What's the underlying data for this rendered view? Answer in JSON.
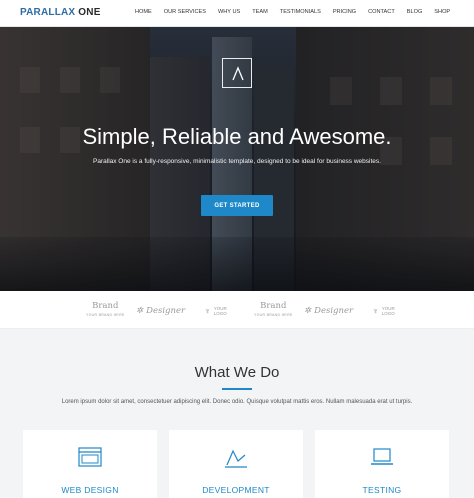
{
  "header": {
    "logo_part1": "PARALLAX",
    "logo_part2": "ONE",
    "nav": [
      "HOME",
      "OUR SERVICES",
      "WHY US",
      "TEAM",
      "TESTIMONIALS",
      "PRICING",
      "CONTACT",
      "BLOG",
      "SHOP"
    ]
  },
  "hero": {
    "badge_icon": "a-logo-icon",
    "title": "Simple, Reliable and Awesome.",
    "subtitle": "Parallax One is a fully-responsive, minimalistic template, designed to be ideal for business websites.",
    "button": "GET STARTED"
  },
  "clients": [
    {
      "type": "brand",
      "text": "Brand",
      "small": "YOUR BRAND HERE",
      "icon": "crown-icon"
    },
    {
      "type": "designer",
      "text": "Designer",
      "icon": "gear-icon"
    },
    {
      "type": "your",
      "line1": "YOUR",
      "line2": "LOGO",
      "icon": "footprint-icon"
    },
    {
      "type": "brand",
      "text": "Brand",
      "small": "YOUR BRAND HERE",
      "icon": "crown-icon"
    },
    {
      "type": "designer",
      "text": "Designer",
      "icon": "gear-icon"
    },
    {
      "type": "your",
      "line1": "YOUR",
      "line2": "LOGO",
      "icon": "footprint-icon"
    }
  ],
  "services": {
    "title": "What We Do",
    "text": "Lorem ipsum dolor sit amet, consectetuer adipiscing elit. Donec odio. Quisque volutpat mattis eros. Nullam malesuada erat ut turpis.",
    "cards": [
      {
        "label": "WEB DESIGN",
        "icon": "browser-icon"
      },
      {
        "label": "DEVELOPMENT",
        "icon": "chart-icon"
      },
      {
        "label": "TESTING",
        "icon": "laptop-icon"
      }
    ]
  },
  "colors": {
    "accent": "#1e88c8",
    "logo_blue": "#2e6da4"
  }
}
